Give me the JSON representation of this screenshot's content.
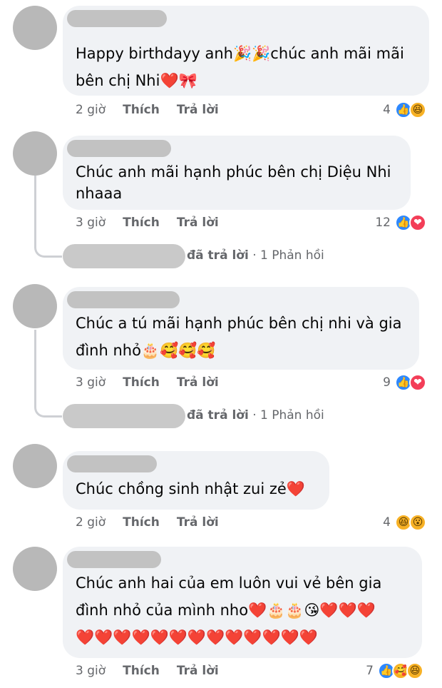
{
  "comments": [
    {
      "lines": [
        "Happy birthdayy anh🎉🎉chúc anh mãi mãi",
        "bên chị Nhi❤️🎀"
      ],
      "time": "2 giờ",
      "like": "Thích",
      "reply": "Trả lời",
      "count": "4",
      "reactions": [
        "👍",
        "😆"
      ]
    },
    {
      "lines": [
        "Chúc anh mãi hạnh phúc bên chị Diệu Nhi",
        "nhaaa"
      ],
      "time": "3 giờ",
      "like": "Thích",
      "reply": "Trả lời",
      "count": "12",
      "reactions": [
        "👍",
        "❤"
      ]
    },
    {
      "lines": [
        "Chúc a tú mãi hạnh phúc bên chị nhi và gia",
        "đình nhỏ🎂🥰🥰🥰"
      ],
      "time": "3 giờ",
      "like": "Thích",
      "reply": "Trả lời",
      "count": "9",
      "reactions": [
        "👍",
        "❤"
      ]
    },
    {
      "lines": [
        "Chúc chồng sinh nhật zui zẻ❤️"
      ],
      "time": "2 giờ",
      "like": "Thích",
      "reply": "Trả lời",
      "count": "4",
      "reactions": [
        "😆",
        "😮"
      ]
    },
    {
      "lines": [
        "Chúc anh hai của em luôn vui vẻ bên gia",
        "đình nhỏ của mình nho❤️🎂🎂😘❤️❤️❤️",
        "❤️❤️❤️❤️❤️❤️❤️❤️❤️❤️❤️❤️❤️"
      ],
      "time": "3 giờ",
      "like": "Thích",
      "reply": "Trả lời",
      "count": "7",
      "reactions": [
        "👍",
        "🥰",
        "😆"
      ]
    }
  ],
  "replies": [
    {
      "action": "đã trả lời",
      "sep": " · ",
      "count": "1 Phản hồi"
    },
    {
      "action": "đã trả lời",
      "sep": " · ",
      "count": "1 Phản hồi"
    }
  ]
}
